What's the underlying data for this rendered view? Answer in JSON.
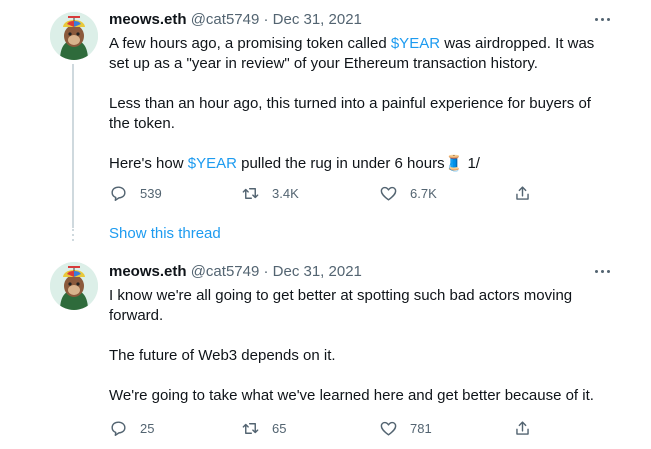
{
  "tweets": [
    {
      "name": "meows.eth",
      "handle": "@cat5749",
      "separator": "·",
      "date": "Dec 31, 2021",
      "paragraphs": [
        [
          "A few hours ago, a promising token called ",
          "$YEAR",
          " was airdropped. It was set up as a \"year in review\" of your Ethereum transaction history."
        ],
        [
          "Less than an hour ago, this turned into a painful experience for buyers of the token."
        ],
        [
          "Here's how ",
          "$YEAR",
          " pulled the rug in under 6 hours",
          "🧵",
          " 1/"
        ]
      ],
      "actions": {
        "reply": "539",
        "retweet": "3.4K",
        "like": "6.7K"
      }
    },
    {
      "name": "meows.eth",
      "handle": "@cat5749",
      "separator": "·",
      "date": "Dec 31, 2021",
      "paragraphs": [
        [
          "I know we're all going to get better at spotting such bad actors moving forward."
        ],
        [
          "The future of Web3 depends on it."
        ],
        [
          "We're going to take what we've learned here and get better because of it."
        ]
      ],
      "actions": {
        "reply": "25",
        "retweet": "65",
        "like": "781"
      }
    }
  ],
  "show_thread_label": "Show this thread",
  "icons": {
    "reply": "reply-icon",
    "retweet": "retweet-icon",
    "like": "heart-icon",
    "share": "share-icon",
    "more": "more-icon"
  },
  "colors": {
    "link": "#1d9bf0",
    "muted": "#536471",
    "text": "#0f1419"
  }
}
